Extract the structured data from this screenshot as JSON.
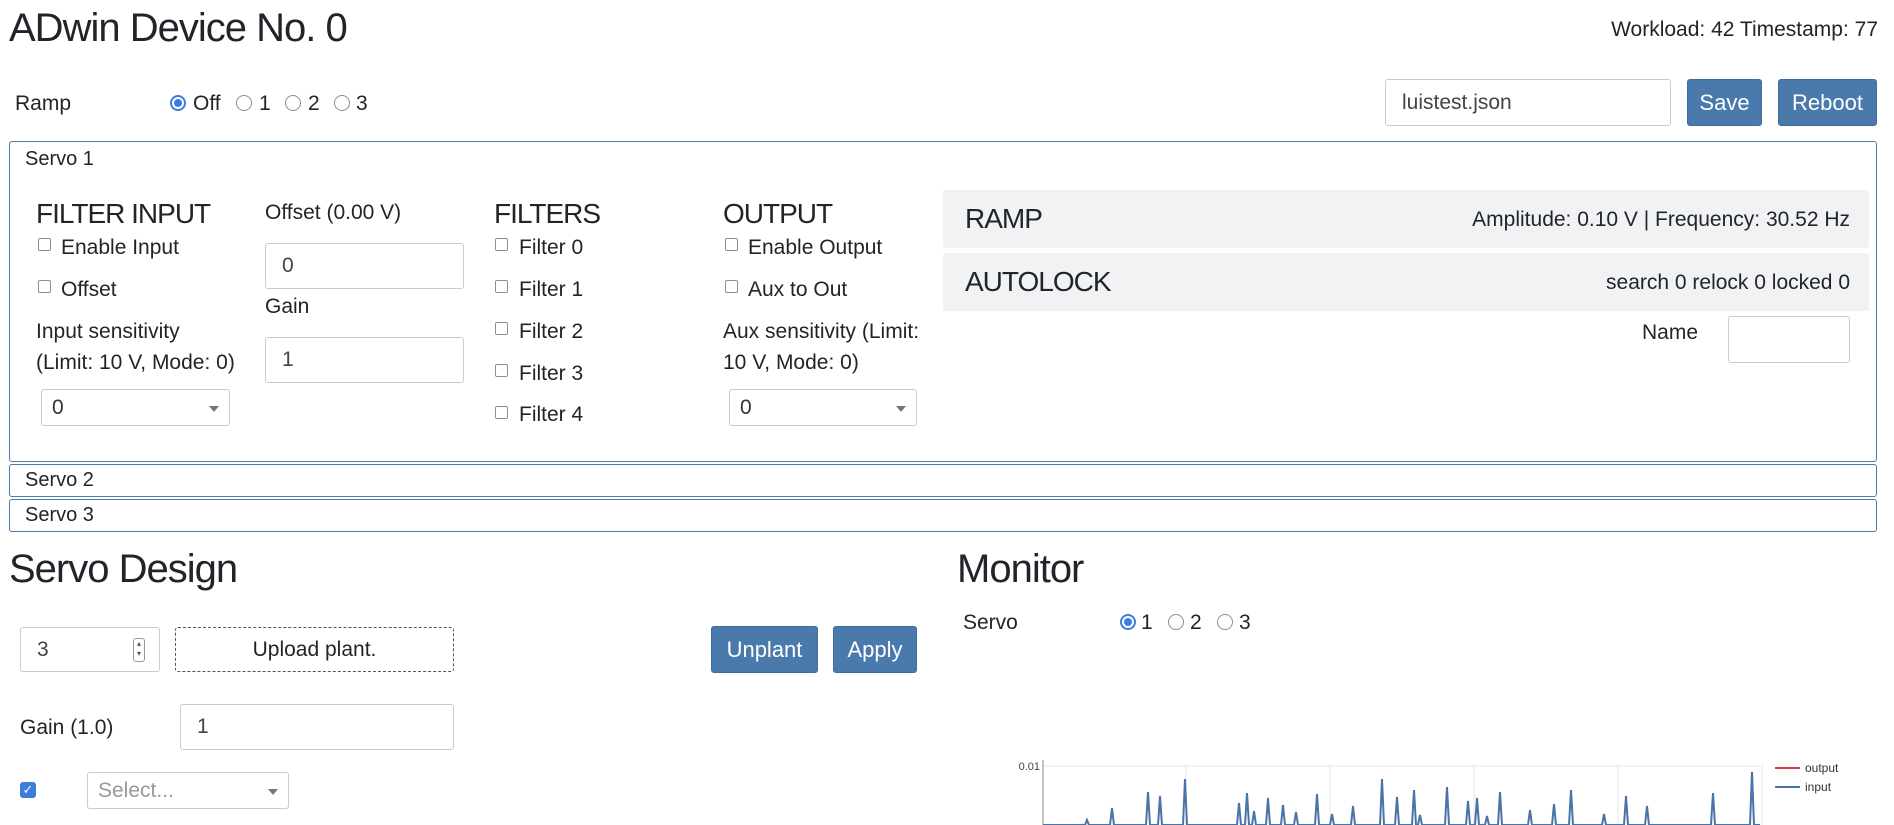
{
  "header": {
    "title": "ADwin Device No. 0",
    "workload_label": "Workload: 42 Timestamp: 77"
  },
  "ramp_bar": {
    "label": "Ramp",
    "options": [
      "Off",
      "1",
      "2",
      "3"
    ],
    "selected": "Off",
    "filename": "luistest.json",
    "save_label": "Save",
    "reboot_label": "Reboot"
  },
  "servo1": {
    "title": "Servo 1",
    "filter_input": {
      "heading": "FILTER INPUT",
      "enable_input_label": "Enable Input",
      "offset_label": "Offset",
      "sensitivity_label_1": "Input sensitivity",
      "sensitivity_label_2": "(Limit: 10 V, Mode: 0)",
      "sensitivity_value": "0"
    },
    "offset_gain": {
      "offset_label": "Offset (0.00 V)",
      "offset_value": "0",
      "gain_label": "Gain",
      "gain_value": "1"
    },
    "filters": {
      "heading": "FILTERS",
      "items": [
        "Filter 0",
        "Filter 1",
        "Filter 2",
        "Filter 3",
        "Filter 4"
      ]
    },
    "output": {
      "heading": "OUTPUT",
      "enable_output_label": "Enable Output",
      "aux_to_out_label": "Aux to Out",
      "aux_label_1": "Aux sensitivity (Limit:",
      "aux_label_2": "10 V, Mode: 0)",
      "aux_value": "0"
    },
    "ramp": {
      "heading": "RAMP",
      "info": "Amplitude: 0.10 V | Frequency: 30.52 Hz"
    },
    "autolock": {
      "heading": "AUTOLOCK",
      "info": "search 0 relock 0 locked 0"
    },
    "name_label": "Name",
    "name_value": ""
  },
  "servo2": {
    "title": "Servo 2"
  },
  "servo3": {
    "title": "Servo 3"
  },
  "servo_design": {
    "heading": "Servo Design",
    "spinner_value": "3",
    "upload_label": "Upload plant.",
    "unplant_label": "Unplant",
    "apply_label": "Apply",
    "gain_label": "Gain (1.0)",
    "gain_value": "1",
    "select_placeholder": "Select...",
    "checkbox_checked": true
  },
  "monitor": {
    "heading": "Monitor",
    "servo_label": "Servo",
    "options": [
      "1",
      "2",
      "3"
    ],
    "selected": "1",
    "colors": {
      "output": "#e0394b",
      "input": "#4a73a8"
    }
  },
  "chart_data": {
    "type": "line",
    "ytick_labels": [
      "0.01"
    ],
    "legend": [
      "output",
      "input"
    ],
    "legend_placement": "top-right",
    "grid": true,
    "series": [
      {
        "name": "output",
        "values": []
      },
      {
        "name": "input",
        "values": []
      }
    ]
  }
}
